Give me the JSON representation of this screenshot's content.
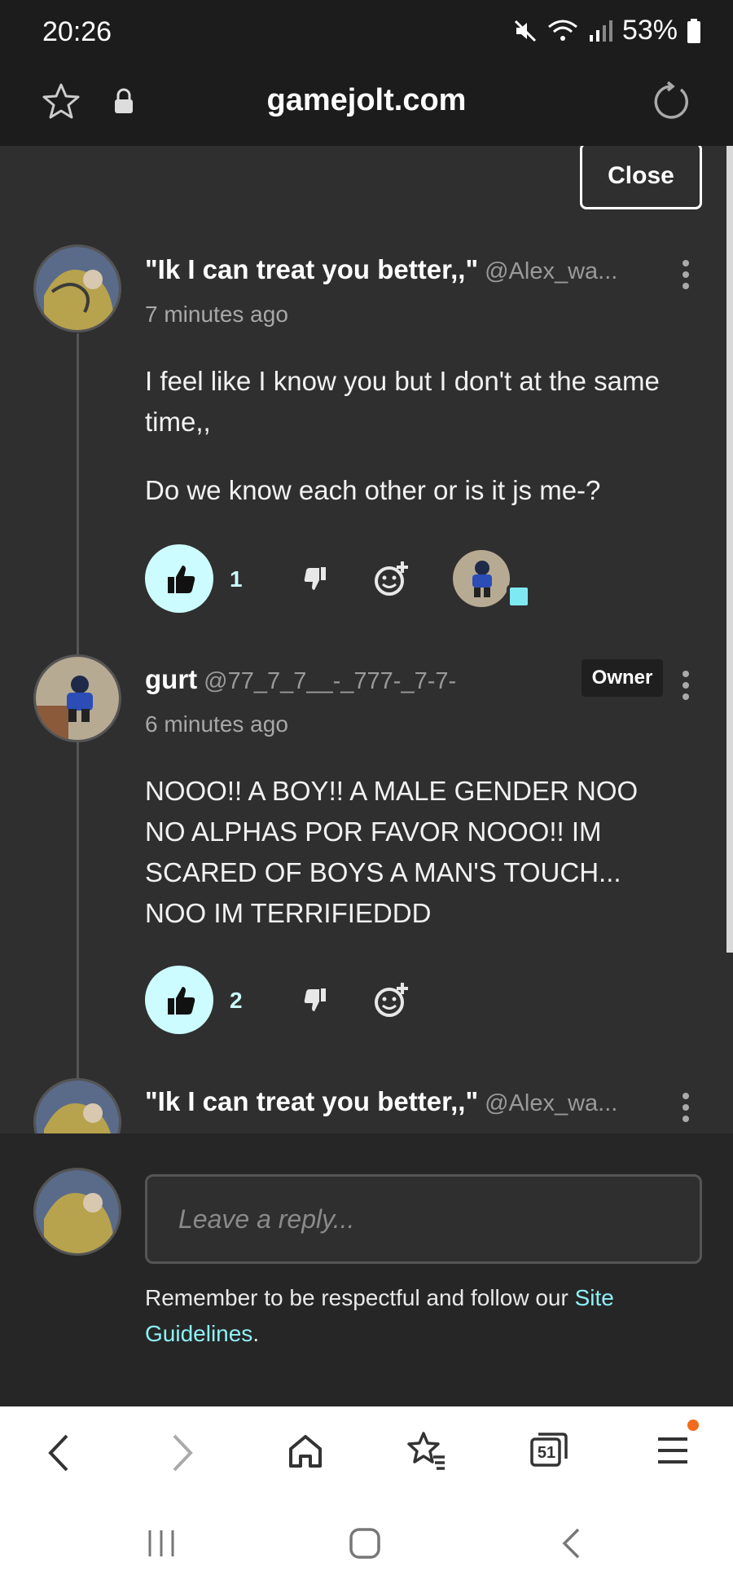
{
  "status": {
    "time": "20:26",
    "battery": "53%"
  },
  "browser": {
    "domain": "gamejolt.com",
    "tabs_count": "51"
  },
  "panel": {
    "close_label": "Close"
  },
  "comments": [
    {
      "name": "\"Ik I can treat you better,,\"",
      "handle": "@Alex_wa...",
      "time": "7 minutes ago",
      "paragraphs": [
        "I feel like I know you but I don't at the same time,,",
        "Do we know each other or is it js me-?"
      ],
      "likes": "1"
    },
    {
      "name": "gurt",
      "handle": "@77_7_7__-_777-_7-7-",
      "badge": "Owner",
      "time": "6 minutes ago",
      "paragraphs": [
        "NOOO!! A BOY!! A MALE GENDER NOO NO ALPHAS POR FAVOR NOOO!! IM SCARED OF BOYS A MAN'S TOUCH... NOO IM TERRIFIEDDD"
      ],
      "likes": "2"
    },
    {
      "name": "\"Ik I can treat you better,,\"",
      "handle": "@Alex_wa..."
    }
  ],
  "reply": {
    "placeholder": "Leave a reply...",
    "reminder_text": "Remember to be respectful and follow our ",
    "guidelines_link": "Site Guidelines",
    "reminder_end": "."
  },
  "colors": {
    "accent": "#ccfcff",
    "link": "#8ef0f7",
    "background": "#2f2f2f"
  }
}
